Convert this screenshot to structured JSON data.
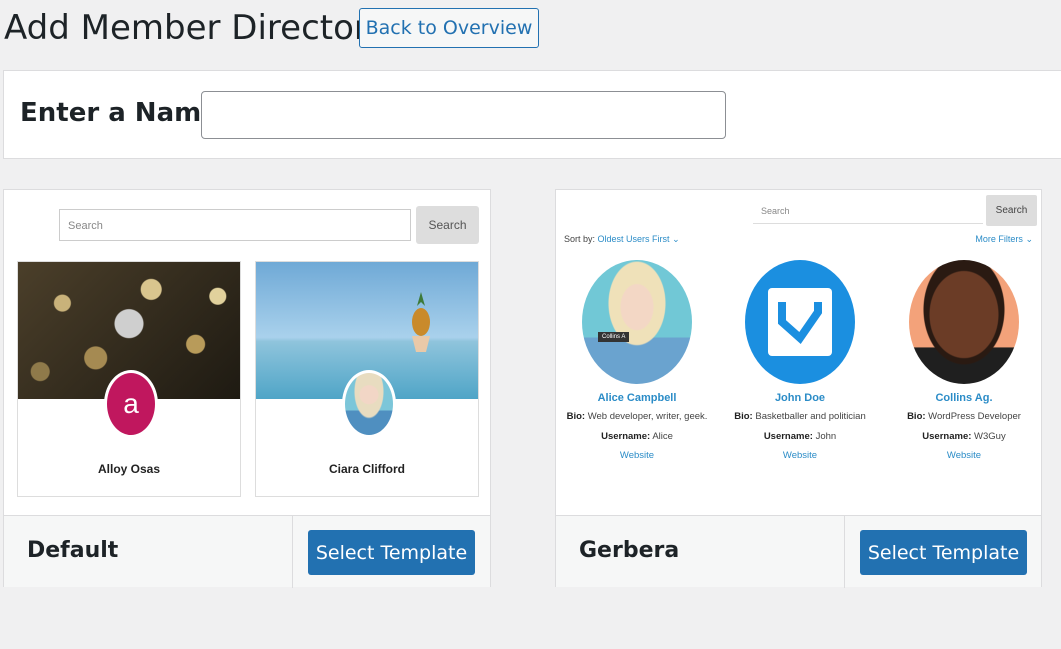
{
  "header": {
    "title": "Add Member Directory",
    "back_label": "Back to Overview"
  },
  "name_section": {
    "label": "Enter a Name",
    "input_value": "",
    "input_placeholder": ""
  },
  "templates": [
    {
      "name": "Default",
      "select_label": "Select Template",
      "preview": {
        "search_placeholder": "Search",
        "search_button": "Search",
        "members": [
          {
            "name": "Alloy Osas",
            "avatar_letter": "a",
            "avatar_color": "#c0175e"
          },
          {
            "name": "Ciara Clifford"
          }
        ]
      }
    },
    {
      "name": "Gerbera",
      "select_label": "Select Template",
      "preview": {
        "search_placeholder": "Search",
        "search_button": "Search",
        "sort_label": "Sort by:",
        "sort_value": "Oldest Users First",
        "filters_label": "More Filters",
        "members": [
          {
            "name": "Alice Campbell",
            "avatar_tag": "Collins A",
            "bio_label": "Bio:",
            "bio": "Web developer, writer, geek.",
            "username_label": "Username:",
            "username": "Alice",
            "website": "Website"
          },
          {
            "name": "John Doe",
            "bio_label": "Bio:",
            "bio": "Basketballer and politician",
            "username_label": "Username:",
            "username": "John",
            "website": "Website"
          },
          {
            "name": "Collins Ag.",
            "bio_label": "Bio:",
            "bio": "WordPress Developer",
            "username_label": "Username:",
            "username": "W3Guy",
            "website": "Website"
          }
        ]
      }
    }
  ],
  "colors": {
    "primary": "#2271b1",
    "link": "#2b8cc7",
    "background": "#f0f0f1"
  }
}
